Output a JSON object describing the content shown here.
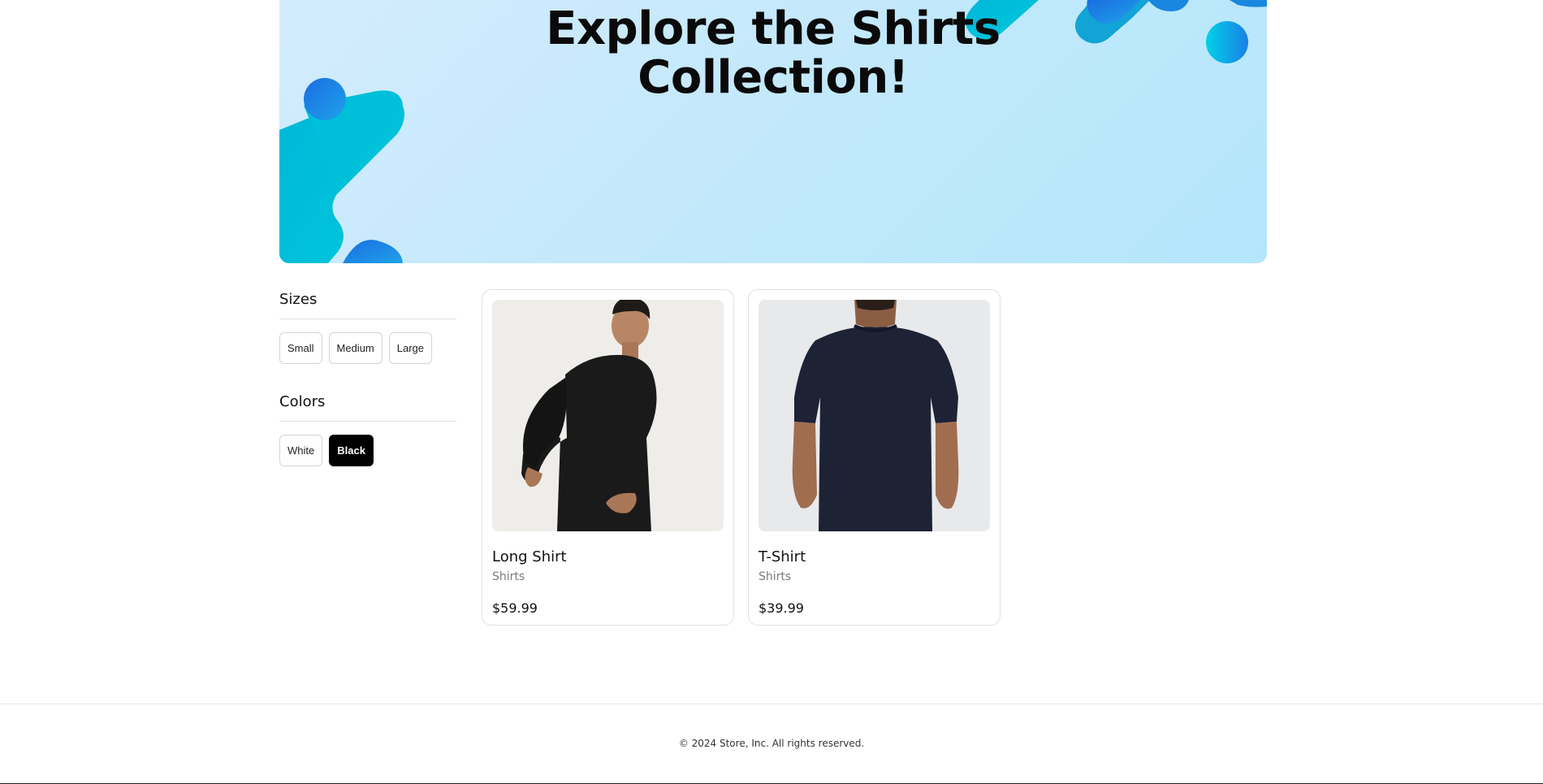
{
  "banner": {
    "title_line1": "Explore the Shirts",
    "title_line2": "Collection!"
  },
  "filters": {
    "sizes": {
      "heading": "Sizes",
      "options": [
        "Small",
        "Medium",
        "Large"
      ]
    },
    "colors": {
      "heading": "Colors",
      "options": [
        "White",
        "Black"
      ],
      "selected": "Black"
    }
  },
  "products": [
    {
      "name": "Long Shirt",
      "category": "Shirts",
      "price": "$59.99",
      "image": "man-in-black-long-sleeve-shirt"
    },
    {
      "name": "T-Shirt",
      "category": "Shirts",
      "price": "$39.99",
      "image": "man-in-navy-t-shirt-back-view"
    }
  ],
  "footer": {
    "copyright": "© 2024 Store, Inc. All rights reserved."
  },
  "colors": {
    "banner_accent": "#00bcd4",
    "banner_accent_blue": "#1e7fe0",
    "selected_chip": "#000000"
  }
}
